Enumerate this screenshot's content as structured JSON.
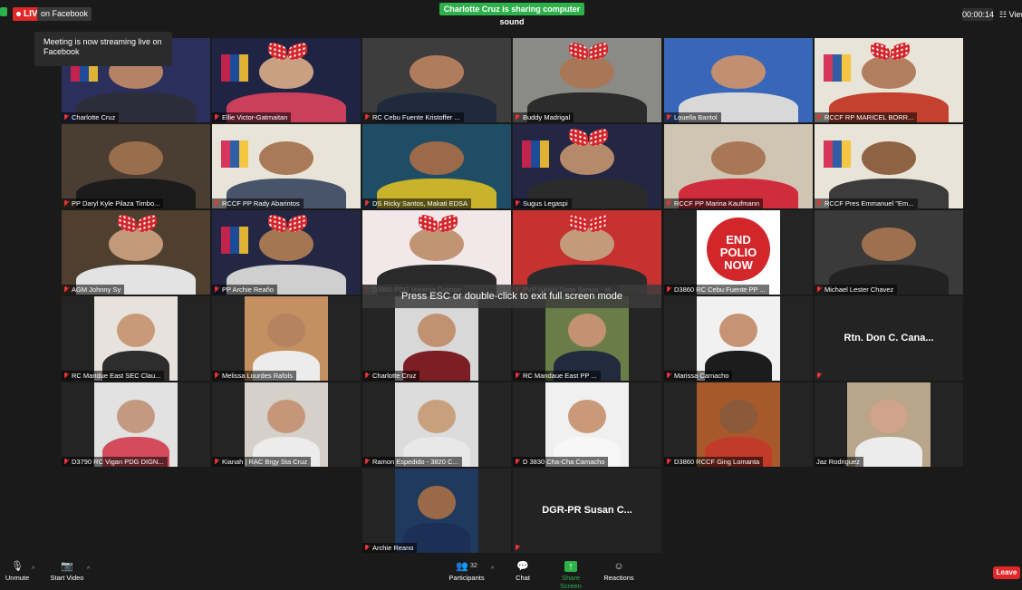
{
  "header": {
    "live_label": "LIVE",
    "on_facebook_label": "on Facebook",
    "sharing_banner": "Charlotte Cruz is sharing computer sound",
    "timer": "00:00:14",
    "view_label": "View",
    "tooltip": "Meeting is now streaming live on Facebook"
  },
  "esc_message": "Press ESC or double-click to exit full screen mode",
  "participants": [
    {
      "name": "Charlotte Cruz",
      "active": true,
      "style": "banner",
      "bg": "#2a2f5c",
      "skin": "#b48366",
      "cloth": "#2d2d3a",
      "bow": true
    },
    {
      "name": "Ellie Victor-Gatmaitan",
      "style": "banner",
      "bg": "#1f2444",
      "skin": "#caa083",
      "cloth": "#c93f5c",
      "bow": true
    },
    {
      "name": "RC Cebu Fuente Kristoffer ...",
      "style": "person",
      "bg": "#3d3d3d",
      "skin": "#b07d5c",
      "cloth": "#1f2a3d"
    },
    {
      "name": "Buddy Madrigal",
      "style": "person",
      "bg": "#8a8a86",
      "skin": "#a77756",
      "cloth": "#2c2c2c",
      "bow": true
    },
    {
      "name": "Louella Bantol",
      "style": "person",
      "bg": "#3866b8",
      "skin": "#c28f70",
      "cloth": "#d8d8d8"
    },
    {
      "name": "RCCF RP MARICEL BORR...",
      "style": "banner",
      "bg": "#e9e4d8",
      "skin": "#b17f60",
      "cloth": "#c4412f",
      "bow": true
    },
    {
      "name": "PP Daryl Kyle Pilaza Timbo...",
      "style": "person",
      "bg": "#4a3e32",
      "skin": "#9a6e4c",
      "cloth": "#1b1b1b"
    },
    {
      "name": "RCCF PP Rady Abarintos",
      "style": "banner",
      "bg": "#e9e4d8",
      "skin": "#a97a58",
      "cloth": "#48546a"
    },
    {
      "name": "DS Ricky Santos, Makati EDSA",
      "style": "person",
      "bg": "#1f4d66",
      "skin": "#9b6a48",
      "cloth": "#c8b32a"
    },
    {
      "name": "Sugus Legaspi",
      "style": "banner",
      "bg": "#232744",
      "skin": "#b58a6a",
      "cloth": "#2b2b2b",
      "bow": true
    },
    {
      "name": "RCCF PP Marina Kaufmann",
      "style": "person",
      "bg": "#cfc5b2",
      "skin": "#a87756",
      "cloth": "#cf2d3b"
    },
    {
      "name": "RCCF Pres Emmanuel \"Em...",
      "style": "banner",
      "bg": "#e9e4d8",
      "skin": "#8f6244",
      "cloth": "#3c3c3c"
    },
    {
      "name": "AGM Johnny Sy",
      "style": "person",
      "bg": "#4f3f2e",
      "skin": "#c29a7a",
      "cloth": "#e3e3e3",
      "bow": true
    },
    {
      "name": "PP Archie Reaño",
      "style": "banner",
      "bg": "#232744",
      "skin": "#a47652",
      "cloth": "#cfcfcf",
      "bow": true
    },
    {
      "name": "D3860 PDG Marietta Quimpo",
      "style": "person",
      "bg": "#f2e8ea",
      "skin": "#c19474",
      "cloth": "#2a2a2a",
      "bow": true
    },
    {
      "name": "PVP NANN Dada Santos - M...",
      "style": "person",
      "bg": "#c5322f",
      "skin": "#c39a7b",
      "cloth": "#2b2b2b",
      "bow": true
    },
    {
      "name": "D3860 RC Cebu Fuente PP ...",
      "style": "poster",
      "bg": "#ffffff",
      "poster_text": "END POLIO NOW"
    },
    {
      "name": "Michael Lester Chavez",
      "style": "person",
      "bg": "#3a3a3a",
      "skin": "#9e704f",
      "cloth": "#222222"
    },
    {
      "name": "RC Mandue East SEC Clau...",
      "style": "photo",
      "bg": "#e7e2dc",
      "skin": "#c89a78",
      "cloth": "#2d2d2d"
    },
    {
      "name": "Melissa Lourdes Rafols",
      "style": "photo",
      "bg": "#c49060",
      "skin": "#b5835f",
      "cloth": "#ececec"
    },
    {
      "name": "Charlotte Cruz",
      "style": "photo",
      "bg": "#d8d8d8",
      "skin": "#c19272",
      "cloth": "#7d1d24"
    },
    {
      "name": "RC Mandaue East PP ...",
      "style": "photo",
      "bg": "#6a7d48",
      "skin": "#c39271",
      "cloth": "#222a3d"
    },
    {
      "name": "Marissa Camacho",
      "style": "photo",
      "bg": "#f1f1f1",
      "skin": "#c69474",
      "cloth": "#1c1c1c"
    },
    {
      "name": "Rtn. Don C. Cana...",
      "style": "nameonly"
    },
    {
      "name": "D3790 RC Vigan PDG DIGN...",
      "style": "photo",
      "bg": "#e2e2e2",
      "skin": "#c39a80",
      "cloth": "#d24c5c"
    },
    {
      "name": "Kianah | RAC Brgy Sta Cruz",
      "style": "photo",
      "bg": "#d6d0ca",
      "skin": "#c5967a",
      "cloth": "#ececec"
    },
    {
      "name": "Ramon Espedido - 3820 C...",
      "style": "photo",
      "bg": "#dcdcdc",
      "skin": "#c8a07e",
      "cloth": "#e8e8e8"
    },
    {
      "name": "D 3830 Cha-Cha Camacho",
      "style": "photo",
      "bg": "#f0f0f0",
      "skin": "#c9997a",
      "cloth": "#f7f7f7"
    },
    {
      "name": "D3860 RCCF Ging Lomanta",
      "style": "photo",
      "bg": "#a8592c",
      "skin": "#8a5a3a",
      "cloth": "#c23b2a"
    },
    {
      "name": "Jaz Rodriguez",
      "style": "photo",
      "bg": "#b8a58a",
      "skin": "#d0a48a",
      "cloth": "#ececec"
    },
    {
      "name": "Archie Reano",
      "style": "photo",
      "bg": "#1f3a5c",
      "skin": "#9a6a48",
      "cloth": "#1c2f55"
    },
    {
      "name": "DGR-PR Susan C...",
      "style": "nameonly"
    }
  ],
  "toolbar": {
    "unmute": "Unmute",
    "start_video": "Start Video",
    "participants": "Participants",
    "participants_count": "32",
    "chat": "Chat",
    "share_screen": "Share Screen",
    "reactions": "Reactions",
    "leave": "Leave"
  }
}
